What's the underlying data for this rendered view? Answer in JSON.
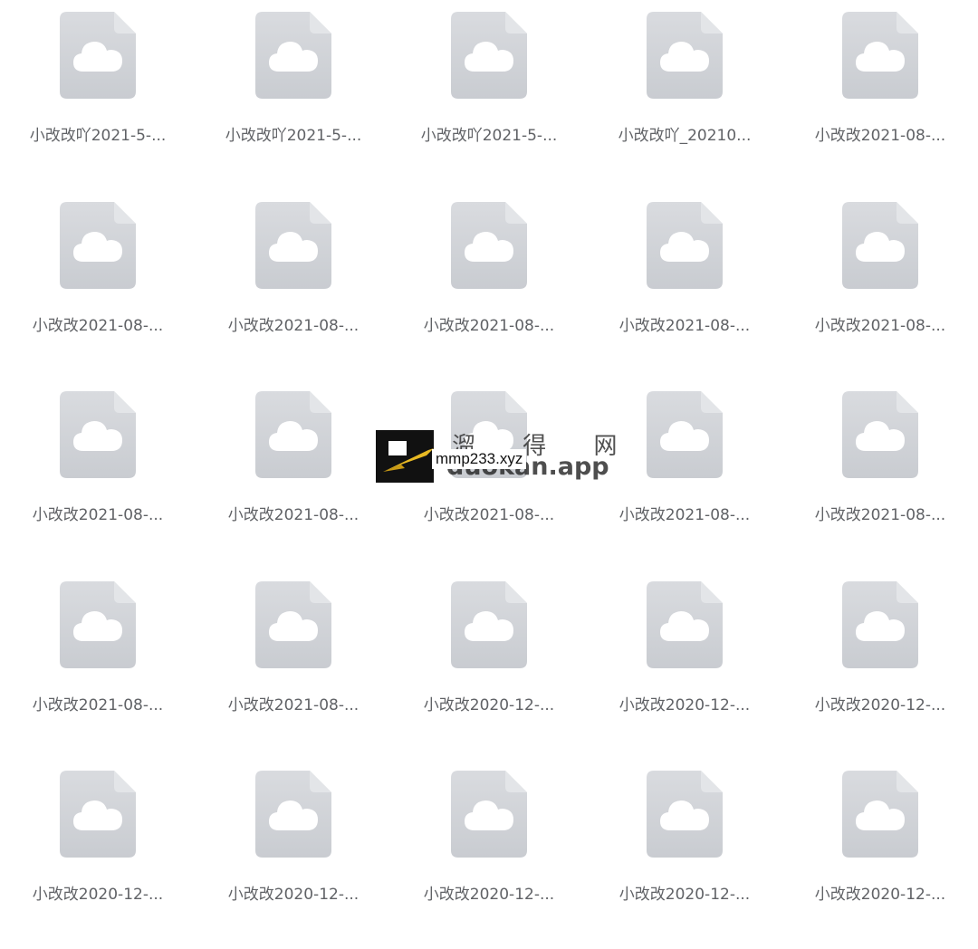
{
  "files": [
    {
      "name": "小改改吖2021-5-..."
    },
    {
      "name": "小改改吖2021-5-..."
    },
    {
      "name": "小改改吖2021-5-..."
    },
    {
      "name": "小改改吖_20210..."
    },
    {
      "name": "小改改2021-08-..."
    },
    {
      "name": "小改改2021-08-..."
    },
    {
      "name": "小改改2021-08-..."
    },
    {
      "name": "小改改2021-08-..."
    },
    {
      "name": "小改改2021-08-..."
    },
    {
      "name": "小改改2021-08-..."
    },
    {
      "name": "小改改2021-08-..."
    },
    {
      "name": "小改改2021-08-..."
    },
    {
      "name": "小改改2021-08-..."
    },
    {
      "name": "小改改2021-08-..."
    },
    {
      "name": "小改改2021-08-..."
    },
    {
      "name": "小改改2021-08-..."
    },
    {
      "name": "小改改2021-08-..."
    },
    {
      "name": "小改改2020-12-..."
    },
    {
      "name": "小改改2020-12-..."
    },
    {
      "name": "小改改2020-12-..."
    },
    {
      "name": "小改改2020-12-..."
    },
    {
      "name": "小改改2020-12-..."
    },
    {
      "name": "小改改2020-12-..."
    },
    {
      "name": "小改改2020-12-..."
    },
    {
      "name": "小改改2020-12-..."
    }
  ],
  "file_icon": "cloud-file-icon",
  "colors": {
    "icon_fill": "#d3d5d9",
    "cloud": "#ffffff",
    "text": "#606266"
  },
  "watermark": {
    "cn_text": "溜 得 网",
    "app_text": "duokan.app",
    "url_text": "mmp233.xyz",
    "logo_icon": "p-logo-icon"
  }
}
